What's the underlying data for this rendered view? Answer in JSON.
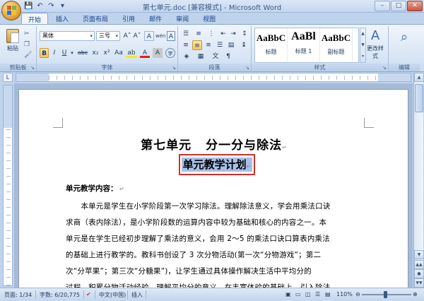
{
  "window": {
    "title": "第七单元.doc [兼容模式] - Microsoft Word",
    "controls": [
      "–",
      "□",
      "✕"
    ]
  },
  "qat": [
    "💾",
    "↶",
    "↷",
    "▾"
  ],
  "tabs": [
    "开始",
    "插入",
    "页面布局",
    "引用",
    "邮件",
    "审阅",
    "视图"
  ],
  "ribbon": {
    "clipboard": {
      "paste": "粘贴",
      "label": "剪贴板"
    },
    "font": {
      "name": "黑体",
      "size": "三号",
      "grow": "A˄",
      "shrink": "A˅",
      "clear": "A",
      "phonetic": "wén",
      "border_char": "A",
      "bold": "B",
      "italic": "I",
      "underline": "U",
      "strike": "abc",
      "subscript": "x₂",
      "superscript": "x²",
      "case": "Aa",
      "highlight": "ab",
      "color": "A",
      "shading": "A",
      "circle": "字",
      "label": "字体"
    },
    "paragraph": {
      "label": "段落"
    },
    "styles": {
      "items": [
        {
          "sample": "AaBbC",
          "name": "标题"
        },
        {
          "sample": "AaBl",
          "name": "标题 1"
        },
        {
          "sample": "AaBbC",
          "name": "副标题"
        }
      ],
      "change": "更改样式",
      "label": "样式"
    },
    "editing": {
      "label": "编辑"
    }
  },
  "document": {
    "title_left": "第七单元",
    "title_right": "分一分与除法",
    "subtitle": "单元教学计划",
    "heading": "单元教学内容：",
    "lines": [
      "　　本单元是学生在小学阶段第一次学习除法。理解除法意义，学会用乘法口诀",
      "求商（表内除法），是小学阶段数的运算内容中较为基础和核心的内容之一。本",
      "单元是在学生已经初步理解了乘法的意义，会用 2～5 的乘法口诀口算表内乘法",
      "的基础上进行教学的。教科书创设了 3 次分物活动(第一次“分物游戏”；第二",
      "次“分苹果”；第三次“分糖果”)，让学生通过具体操作解决生活中平均分的",
      "过程，积累分物活动经验，理解平均分的意义，在丰富体验的基础上，引入除法"
    ]
  },
  "status": {
    "page": "页面: 1/34",
    "words": "字数: 6/20,775",
    "language": "中文(中国)",
    "mode": "插入",
    "zoom": "110%"
  }
}
